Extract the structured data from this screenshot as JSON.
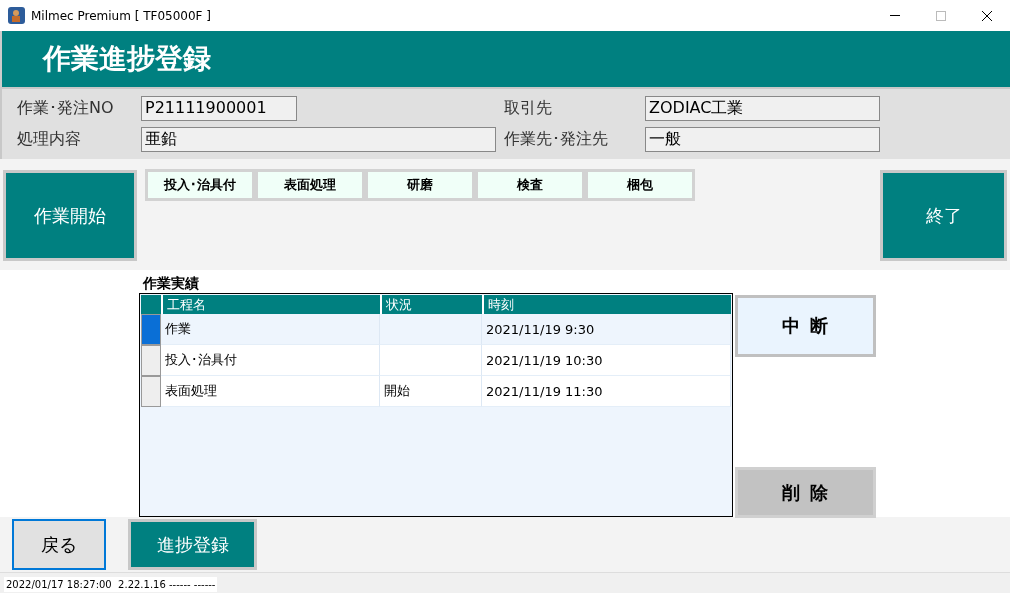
{
  "window": {
    "title": "Milmec Premium [ TF05000F ]"
  },
  "header": {
    "title": "作業進捗登録"
  },
  "info": [
    {
      "label": "作業･発注NO",
      "value": "P21111900001"
    },
    {
      "label": "取引先",
      "value": "ZODIAC工業"
    },
    {
      "label": "処理内容",
      "value": "亜鉛"
    },
    {
      "label": "作業先･発注先",
      "value": "一般"
    }
  ],
  "start_button": {
    "label": "作業開始",
    "kind": "primary"
  },
  "processes": [
    "投入･治具付",
    "表面処理",
    "研磨",
    "検査",
    "梱包"
  ],
  "end_button": {
    "label": "終了",
    "kind": "primary"
  },
  "results": {
    "title": "作業実績",
    "columns": [
      "工程名",
      "状況",
      "時刻"
    ],
    "rows": [
      {
        "cells": [
          "作業",
          "",
          "2021/11/19 9:30"
        ],
        "selected": true
      },
      {
        "cells": [
          "投入･治具付",
          "",
          "2021/11/19 10:30"
        ],
        "selected": false
      },
      {
        "cells": [
          "表面処理",
          "開始",
          "2021/11/19 11:30"
        ],
        "selected": false
      }
    ]
  },
  "side_buttons": [
    {
      "label": "中 断",
      "kind": "light"
    },
    {
      "label": "削 除",
      "kind": "grey"
    }
  ],
  "footer_buttons": [
    {
      "label": "戻る",
      "kind": "plain",
      "focused": true
    },
    {
      "label": "進捗登録",
      "kind": "primary",
      "focused": false
    }
  ],
  "status_bar": "2022/01/17 18:27:00  2.22.1.16 ------ ------"
}
